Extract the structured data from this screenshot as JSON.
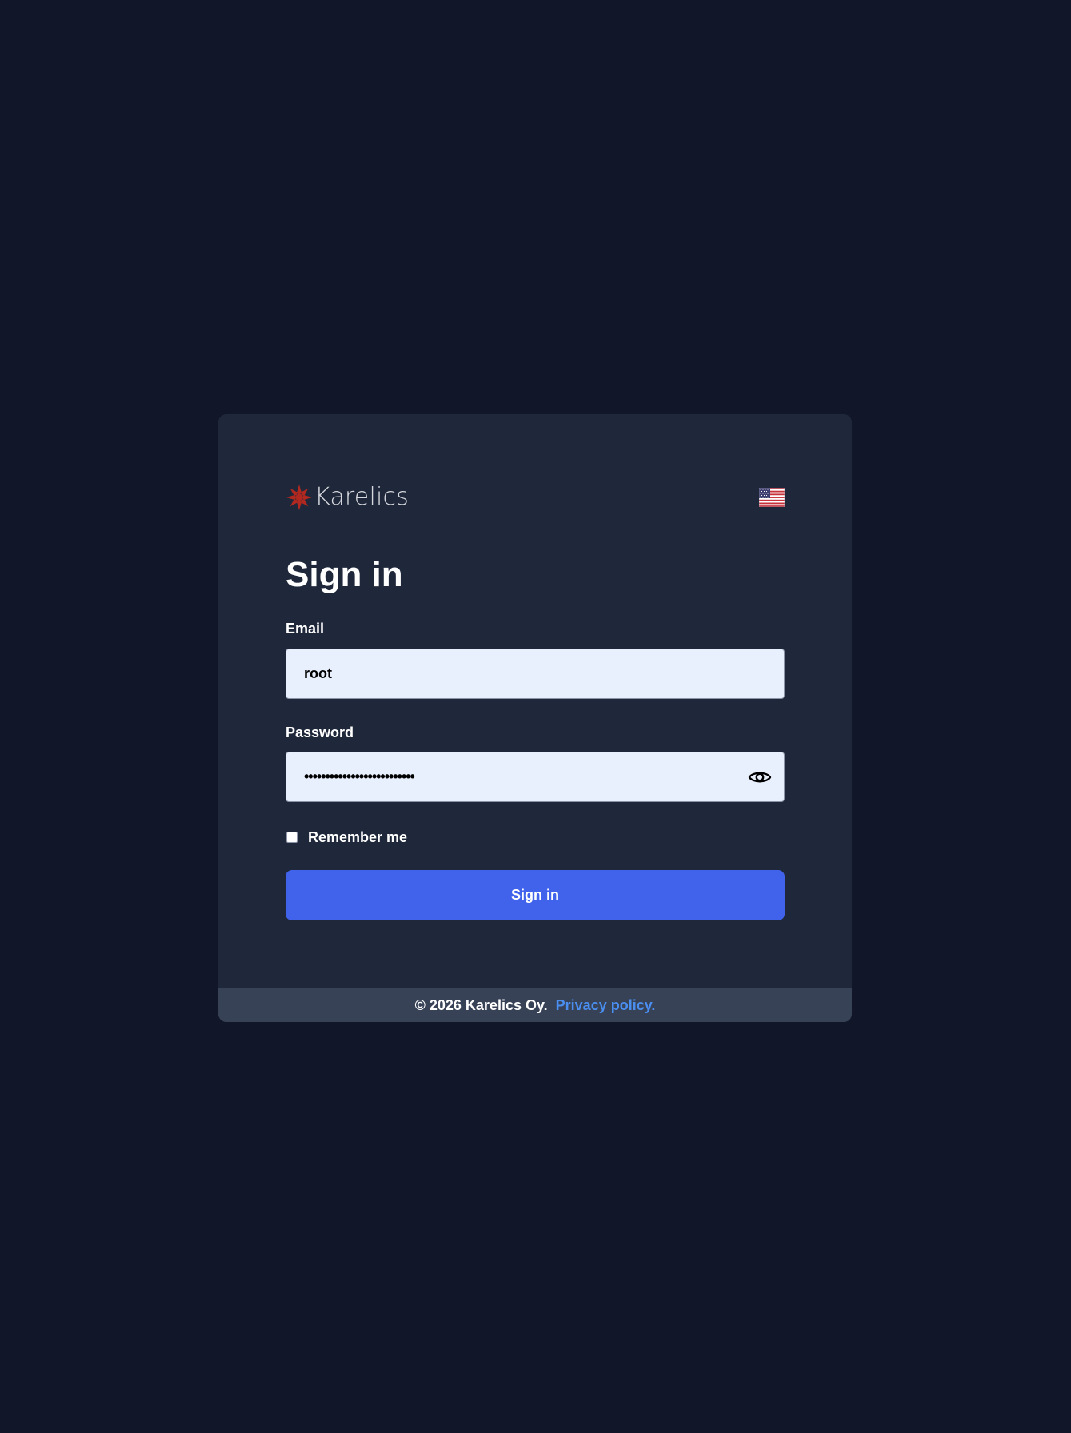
{
  "brand": {
    "name": "Karelics",
    "logo_icon": "karelics-star-icon",
    "logo_color": "#b0281f"
  },
  "language": {
    "flag_icon": "us-flag-icon",
    "current": "en-US"
  },
  "form": {
    "title": "Sign in",
    "email": {
      "label": "Email",
      "value": "root"
    },
    "password": {
      "label": "Password",
      "value": "••••••••••••••••••••••••••",
      "toggle_icon": "eye-icon"
    },
    "remember": {
      "label": "Remember me",
      "checked": false
    },
    "submit_label": "Sign in"
  },
  "footer": {
    "copyright": "© 2026 Karelics Oy.",
    "privacy_link": "Privacy policy."
  },
  "colors": {
    "page_bg": "#111729",
    "card_bg": "#1f283b",
    "footer_bg": "#374257",
    "input_bg": "#e9f0fd",
    "button_bg": "#4163eb",
    "link": "#4a8ef0"
  }
}
